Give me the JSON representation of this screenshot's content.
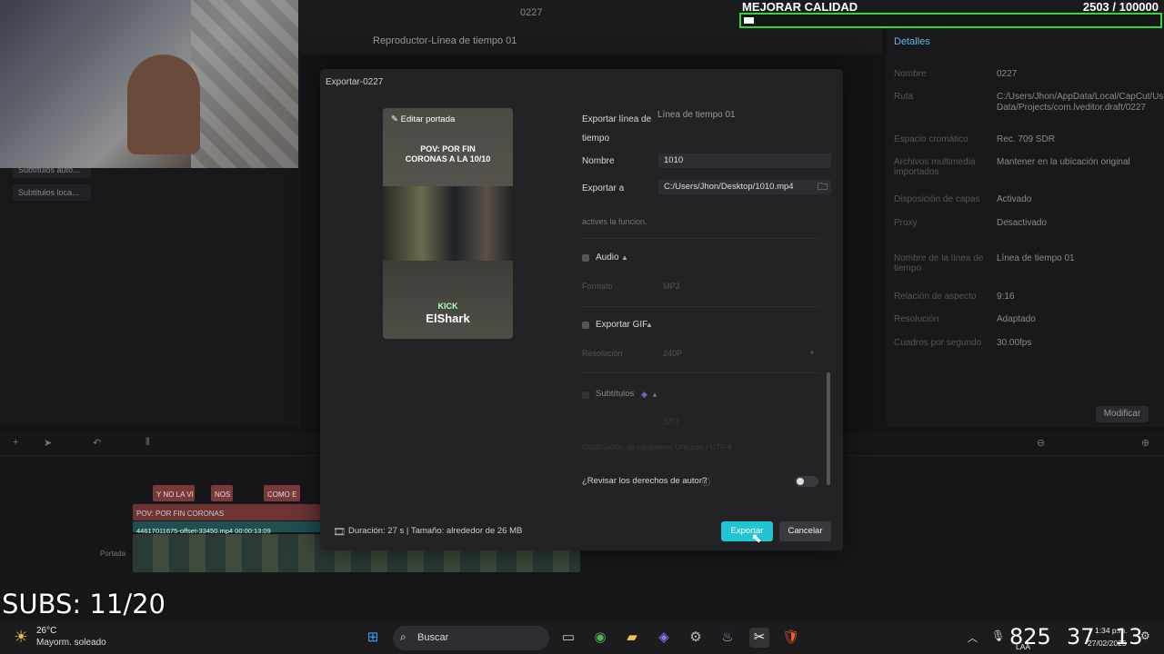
{
  "editor": {
    "project_name": "0227",
    "player_title": "Reproductor-Línea de tiempo 01",
    "left_items": [
      "Subtítulos auto...",
      "Subtítulos loca..."
    ],
    "details_title": "Detalles",
    "details": [
      {
        "k": "Nombre",
        "v": "0227"
      },
      {
        "k": "Ruta",
        "v": "C:/Users/Jhon/AppData/Local/CapCut/User Data/Projects/com.lveditor.draft/0227"
      },
      {
        "k": "Espacio cromático",
        "v": "Rec. 709 SDR"
      },
      {
        "k": "Archivos multimedia importados",
        "v": "Mantener en la ubicación original"
      },
      {
        "k": "Disposición de capas",
        "v": "Activado"
      },
      {
        "k": "Proxy",
        "v": "Desactivado"
      },
      {
        "k": "Nombre de la línea de tiempo",
        "v": "Línea de tiempo 01"
      },
      {
        "k": "Relación de aspecto",
        "v": "9:16"
      },
      {
        "k": "Resolución",
        "v": "Adaptado"
      },
      {
        "k": "Cuadros por segundo",
        "v": "30.00fps"
      }
    ],
    "modify_label": "Modificar",
    "tracks": {
      "text_clips": [
        "Y NO LA VI",
        "NOS",
        "COMO E"
      ],
      "title_clip": "POV: POR FIN CORONAS",
      "video_clip": "44617011675-offset-33450.mp4   00:00:13:09",
      "cover_label": "Portada"
    }
  },
  "overlay": {
    "goal_title": "MEJORAR CALIDAD",
    "goal_count": "2503 / 100000",
    "goal_progress": 0.025,
    "subs": "SUBS: 11/20"
  },
  "dialog": {
    "title": "Exportar-0227",
    "edit_cover": "Editar portada",
    "cover_caption": "POV: POR FIN CORONAS A LA 10/10",
    "cover_kick": "KICK",
    "cover_name": "ElShark",
    "export_timeline_label": "Exportar línea de tiempo",
    "export_timeline_value": "Línea de tiempo 01",
    "name_label": "Nombre",
    "name_value": "1010",
    "export_to_label": "Exportar a",
    "export_to_value": "C:/Users/Jhon/Desktop/1010.mp4",
    "activate_text": "actives la funcion.",
    "audio_label": "Audio",
    "audio_format_label": "Formato",
    "audio_format_value": "MP3",
    "gif_label": "Exportar GIF",
    "gif_res_label": "Resolución",
    "gif_res_value": "240P",
    "subtitles_label": "Subtítulos",
    "subtitles_format_value": "SRT",
    "subtitles_encoding": "Codificación de caracteres  Unicode / UTF-8",
    "copyright_label": "¿Revisar los derechos de autor?",
    "footer": "Duración: 27 s | Tamaño: alrededor de 26 MB",
    "export_button": "Exportar",
    "cancel_button": "Cancelar"
  },
  "taskbar": {
    "temp": "26°C",
    "weather": "Mayorm. soleado",
    "search": "Buscar",
    "clock_big_1": "825",
    "clock_big_2": "37",
    "clock_big_3": "13",
    "clock_time": "1:34 p.m.",
    "clock_date": "27/02/2025",
    "lang": "LAA"
  }
}
